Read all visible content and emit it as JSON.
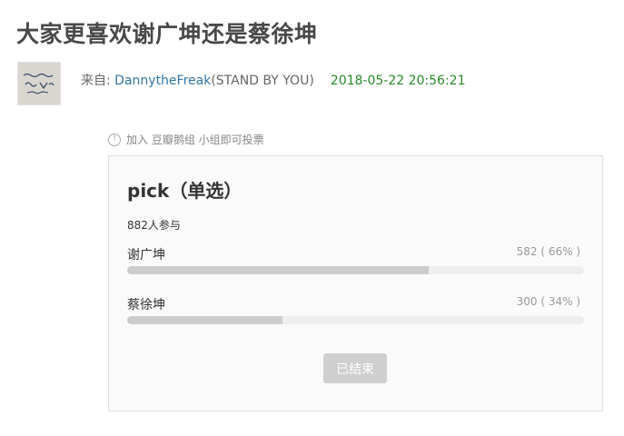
{
  "topic": {
    "title": "大家更喜欢谢广坤还是蔡徐坤"
  },
  "author": {
    "from_label": "来自: ",
    "name": "DannytheFreak",
    "group": "(STAND BY YOU)",
    "timestamp": "2018-05-22 20:56:21"
  },
  "notice": {
    "icon": "info-icon",
    "text": "加入 豆瓣鹅组 小组即可投票"
  },
  "poll": {
    "title": "pick（单选）",
    "participants": "882人参与",
    "options": [
      {
        "label": "谢广坤",
        "stat": "582 ( 66% )",
        "percent": 66
      },
      {
        "label": "蔡徐坤",
        "stat": "300 ( 34% )",
        "percent": 34
      }
    ],
    "button_label": "已结束"
  }
}
